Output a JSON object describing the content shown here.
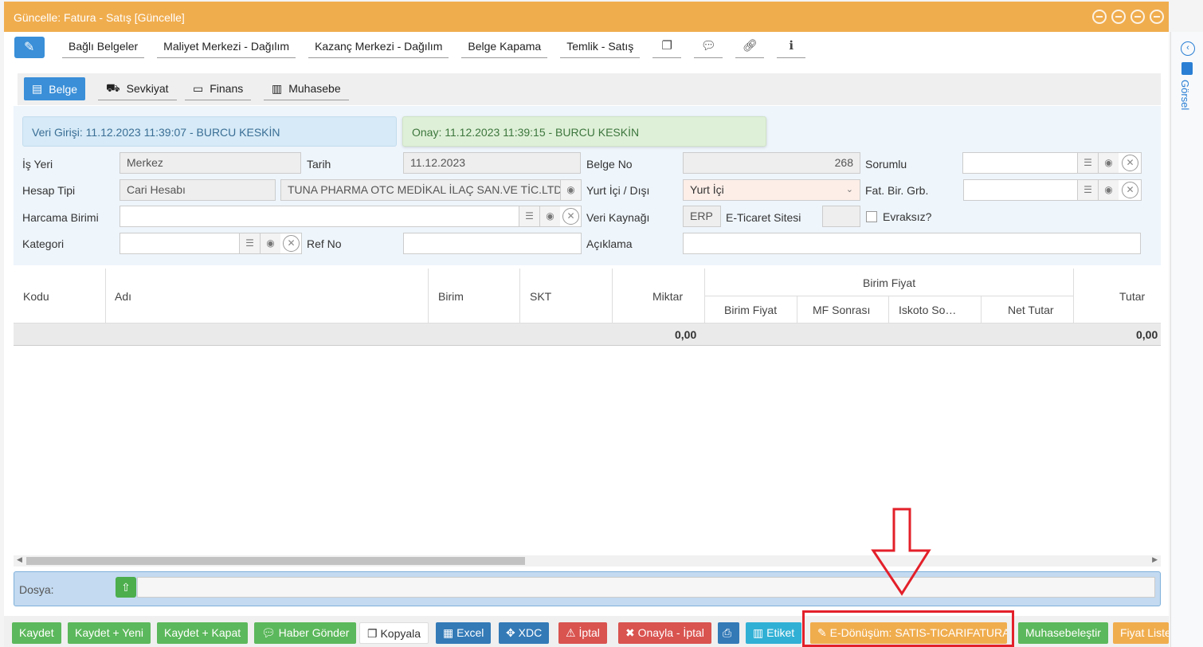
{
  "window": {
    "title": "Güncelle: Fatura - Satış [Güncelle]"
  },
  "toolbar": {
    "links": [
      "Bağlı Belgeler",
      "Maliyet Merkezi - Dağılım",
      "Kazanç Merkezi - Dağılım",
      "Belge Kapama",
      "Temlik - Satış"
    ]
  },
  "tabs": [
    "Belge",
    "Sevkiyat",
    "Finans",
    "Muhasebe"
  ],
  "right_rail": {
    "label": "Görsel"
  },
  "info": {
    "entry": "Veri Girişi: 11.12.2023 11:39:07 - BURCU KESKİN",
    "approval": "Onay: 11.12.2023 11:39:15 - BURCU KESKİN"
  },
  "form": {
    "is_yeri_label": "İş Yeri",
    "is_yeri": "Merkez",
    "tarih_label": "Tarih",
    "tarih": "11.12.2023",
    "belge_no_label": "Belge No",
    "belge_no": "268",
    "sorumlu_label": "Sorumlu",
    "hesap_tipi_label": "Hesap Tipi",
    "hesap_tipi": "Cari Hesabı",
    "cari": "TUNA PHARMA OTC MEDİKAL İLAÇ SAN.VE TİC.LTD.ŞTİ",
    "yurt_label": "Yurt İçi / Dışı",
    "yurt": "Yurt İçi",
    "fat_bir_label": "Fat. Bir. Grb.",
    "harcama_label": "Harcama Birimi",
    "veri_kaynagi_label": "Veri Kaynağı",
    "veri_kaynagi": "ERP",
    "eticaret_label": "E-Ticaret Sitesi",
    "evraksiz_label": "Evraksız?",
    "kategori_label": "Kategori",
    "ref_no_label": "Ref No",
    "aciklama_label": "Açıklama"
  },
  "grid": {
    "cols": {
      "kodu": "Kodu",
      "adi": "Adı",
      "birim": "Birim",
      "skt": "SKT",
      "miktar": "Miktar",
      "birim_fiyat_group": "Birim Fiyat",
      "birim_fiyat": "Birim Fiyat",
      "mf_sonrasi": "MF Sonrası",
      "iskoto": "Iskoto So…",
      "net_tutar": "Net Tutar",
      "tutar": "Tutar"
    },
    "sum_miktar": "0,00",
    "sum_tutar": "0,00"
  },
  "dosya": {
    "label": "Dosya:"
  },
  "bottom": {
    "kaydet": "Kaydet",
    "kaydet_yeni": "Kaydet + Yeni",
    "kaydet_kapat": "Kaydet + Kapat",
    "haber": "Haber Gönder",
    "kopyala": "Kopyala",
    "excel": "Excel",
    "xdc": "XDC",
    "iptal": "İptal",
    "onayla_iptal": "Onayla - İptal",
    "etiket": "Etiket",
    "edonusum": "E-Dönüşüm: SATIS-TICARIFATURA",
    "muhasebelestir": "Muhasebeleştir",
    "fiyat": "Fiyat Listesi"
  },
  "colors": {
    "title_bar": "#f0ad4e",
    "primary": "#3a8fd8",
    "annotation": "#e3202a"
  }
}
